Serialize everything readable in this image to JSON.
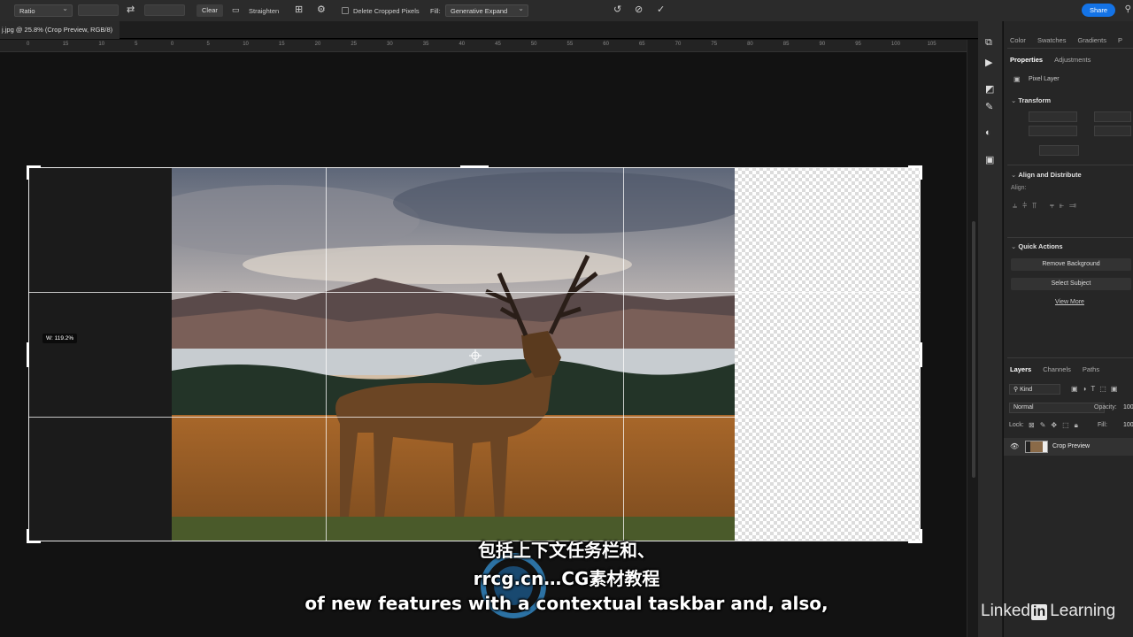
{
  "options_bar": {
    "ratio_label": "Ratio",
    "clear_label": "Clear",
    "straighten_label": "Straighten",
    "delete_cropped_label": "Delete Cropped Pixels",
    "fill_label": "Fill:",
    "fill_value": "Generative Expand",
    "share_label": "Share"
  },
  "document": {
    "tab_title": "j.jpg @ 25.8% (Crop Preview, RGB/8)"
  },
  "ruler": {
    "ticks": [
      "0",
      "15",
      "10",
      "5",
      "0",
      "5",
      "10",
      "15",
      "20",
      "25",
      "30",
      "35",
      "40",
      "45",
      "50",
      "55",
      "60",
      "65",
      "70",
      "75",
      "80",
      "85",
      "90",
      "95",
      "100",
      "105"
    ]
  },
  "crop": {
    "width_readout": "W: 119.2%"
  },
  "right_panels": {
    "top_tabs": [
      "Color",
      "Swatches",
      "Gradients",
      "P"
    ],
    "properties_tabs": [
      "Properties",
      "Adjustments"
    ],
    "layer_type": "Pixel Layer",
    "transform_title": "Transform",
    "align_title": "Align and Distribute",
    "align_label": "Align:",
    "quick_actions_title": "Quick Actions",
    "remove_background": "Remove Background",
    "select_subject": "Select Subject",
    "view_more": "View More",
    "layers_tabs": [
      "Layers",
      "Channels",
      "Paths"
    ],
    "kind_label": "Kind",
    "blend_mode": "Normal",
    "opacity_label": "Opacity:",
    "opacity_value": "100",
    "lock_label": "Lock:",
    "fill_label": "Fill:",
    "fill_value": "100",
    "layer_name": "Crop Preview"
  },
  "subtitles": {
    "line1": "包括上下文任务栏和、",
    "line2": "rrcg.cn…CG素材教程",
    "line3": "of new features with a contextual taskbar and, also,"
  },
  "branding": {
    "linkedin_left": "Linked",
    "linkedin_in": "in",
    "linkedin_right": "Learning"
  }
}
